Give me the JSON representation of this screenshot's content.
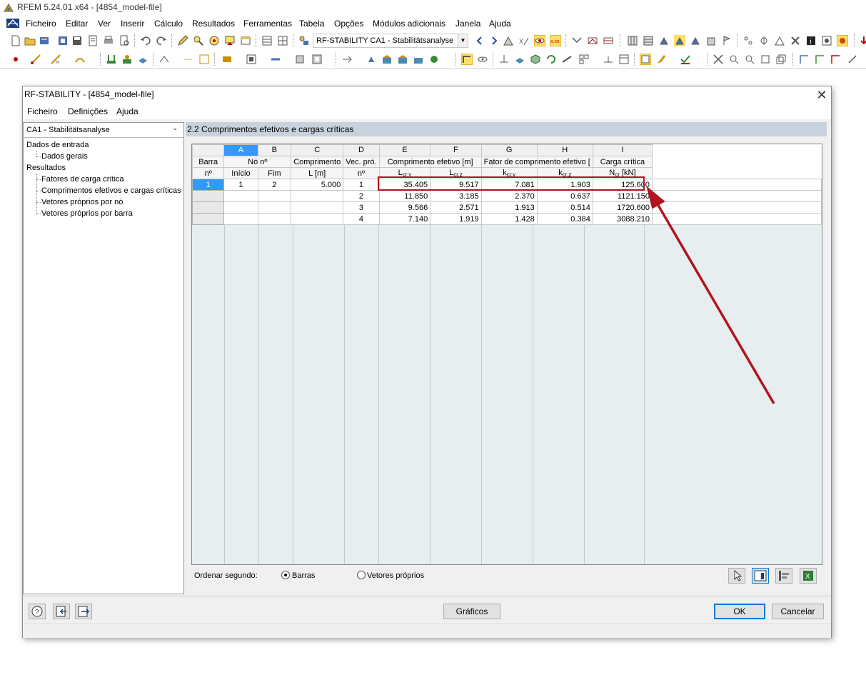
{
  "app": {
    "title": "RFEM 5.24.01 x64 - [4854_model-file]",
    "menu": [
      "Ficheiro",
      "Editar",
      "Ver",
      "Inserir",
      "Cálculo",
      "Resultados",
      "Ferramentas",
      "Tabela",
      "Opções",
      "Módulos adicionais",
      "Janela",
      "Ajuda"
    ],
    "toolbar_combo": "RF-STABILITY CA1 - Stabilitätsanalyse"
  },
  "dialog": {
    "title": "RF-STABILITY - [4854_model-file]",
    "menu": [
      "Ficheiro",
      "Definições",
      "Ajuda"
    ],
    "case_combo": "CA1 - Stabilitätsanalyse",
    "tree": {
      "input_group": "Dados de entrada",
      "input_items": [
        "Dados gerais"
      ],
      "results_group": "Resultados",
      "results_items": [
        "Fatores de carga crítica",
        "Comprimentos efetivos e cargas críticas",
        "Vetores próprios por nó",
        "Vetores próprios por barra"
      ]
    },
    "panel_title": "2.2 Comprimentos efetivos e cargas críticas",
    "grid": {
      "col_letters": [
        "A",
        "B",
        "C",
        "D",
        "E",
        "F",
        "G",
        "H",
        "I"
      ],
      "hdr1": {
        "barra": "Barra",
        "no": "Nó nº",
        "comprimento": "Comprimento",
        "vec": "Vec. pró.",
        "comp_efetivo": "Comprimento efetivo [m]",
        "fator": "Fator de comprimento efetivo [",
        "carga": "Carga crítica"
      },
      "hdr2": {
        "barra_no": "nº",
        "inicio": "Início",
        "fim": "Fim",
        "l": "L [m]",
        "vec_no": "nº",
        "lcry_main": "L",
        "lcry_sub": "cr,y",
        "lcrz_main": "L",
        "lcrz_sub": "cr,z",
        "kcry_main": "k",
        "kcry_sub": "cr,y",
        "kcrz_main": "k",
        "kcrz_sub": "cr,z",
        "ncr_main": "N",
        "ncr_sub": "cr",
        "ncr_unit": " [kN]"
      },
      "rows": [
        {
          "barra": "1",
          "inicio": "1",
          "fim": "2",
          "l": "5.000",
          "vec": "1",
          "lcry": "35.405",
          "lcrz": "9.517",
          "kcry": "7.081",
          "kcrz": "1.903",
          "ncr": "125.600"
        },
        {
          "barra": "",
          "inicio": "",
          "fim": "",
          "l": "",
          "vec": "2",
          "lcry": "11.850",
          "lcrz": "3.185",
          "kcry": "2.370",
          "kcrz": "0.637",
          "ncr": "1121.150"
        },
        {
          "barra": "",
          "inicio": "",
          "fim": "",
          "l": "",
          "vec": "3",
          "lcry": "9.566",
          "lcrz": "2.571",
          "kcry": "1.913",
          "kcrz": "0.514",
          "ncr": "1720.600"
        },
        {
          "barra": "",
          "inicio": "",
          "fim": "",
          "l": "",
          "vec": "4",
          "lcry": "7.140",
          "lcrz": "1.919",
          "kcry": "1.428",
          "kcrz": "0.384",
          "ncr": "3088.210"
        }
      ]
    },
    "sort": {
      "label": "Ordenar segundo:",
      "opt1": "Barras",
      "opt2": "Vetores próprios",
      "selected": "Barras"
    },
    "buttons": {
      "graficos": "Gráficos",
      "ok": "OK",
      "cancel": "Cancelar"
    }
  },
  "colors": {
    "highlight": "#b0141e",
    "selection": "#3399ff",
    "panel_header": "#c8d2dc"
  }
}
